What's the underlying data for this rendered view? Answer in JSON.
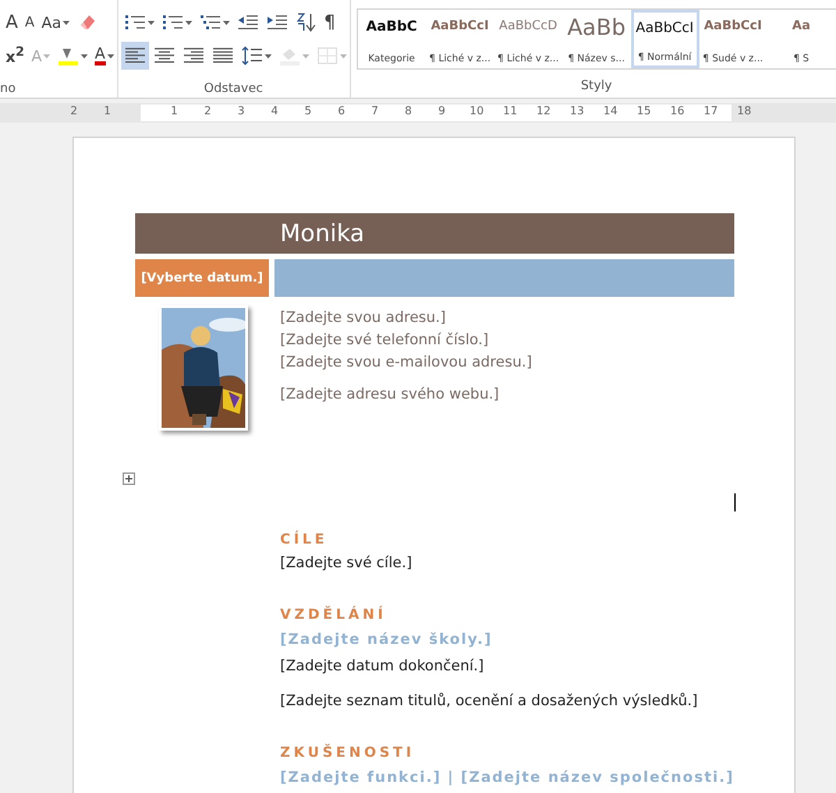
{
  "ribbon": {
    "groups": [
      {
        "label": "no",
        "rows": [
          [
            {
              "kind": "grow",
              "label": "A",
              "dropdown": false,
              "disabled": false,
              "selected": false
            },
            {
              "kind": "shrink",
              "label": "A",
              "dropdown": false,
              "disabled": false,
              "selected": false
            },
            {
              "kind": "case",
              "label": "Aa",
              "dropdown": true,
              "disabled": false,
              "selected": false
            },
            {
              "kind": "eraser",
              "dropdown": false,
              "disabled": false,
              "selected": false
            }
          ],
          [
            {
              "kind": "superscript",
              "label": "x$^{2}$",
              "dropdown": false,
              "disabled": false,
              "selected": false
            },
            {
              "kind": "effects",
              "label": "A",
              "dropdown": true,
              "disabled": true,
              "selected": false
            },
            {
              "kind": "highlight",
              "dropdown": true,
              "disabled": false,
              "selected": false
            },
            {
              "kind": "font-color",
              "label": "A",
              "dropdown": true,
              "disabled": false,
              "selected": false
            }
          ]
        ]
      },
      {
        "label": "Odstavec",
        "rows": [
          [
            {
              "kind": "bullets",
              "dropdown": true,
              "disabled": false,
              "selected": false
            },
            {
              "kind": "numbering",
              "dropdown": true,
              "disabled": false,
              "selected": false
            },
            {
              "kind": "multilevel",
              "dropdown": true,
              "disabled": false,
              "selected": false
            },
            {
              "kind": "outdent",
              "dropdown": false,
              "disabled": false,
              "selected": false
            },
            {
              "kind": "indent",
              "dropdown": false,
              "disabled": false,
              "selected": false
            },
            {
              "kind": "sort",
              "dropdown": false,
              "disabled": false,
              "selected": false
            },
            {
              "kind": "pilcrow",
              "label": "¶",
              "dropdown": false,
              "disabled": false,
              "selected": false
            }
          ],
          [
            {
              "kind": "align-left",
              "dropdown": false,
              "disabled": false,
              "selected": true
            },
            {
              "kind": "align-center",
              "dropdown": false,
              "disabled": false,
              "selected": false
            },
            {
              "kind": "align-right",
              "dropdown": false,
              "disabled": false,
              "selected": false
            },
            {
              "kind": "justify",
              "dropdown": false,
              "disabled": false,
              "selected": false
            },
            {
              "kind": "line-spacing",
              "dropdown": true,
              "disabled": false,
              "selected": false
            },
            {
              "kind": "shading",
              "dropdown": true,
              "disabled": true,
              "selected": false
            },
            {
              "kind": "borders",
              "dropdown": true,
              "disabled": true,
              "selected": false
            }
          ]
        ]
      }
    ],
    "styles": {
      "label": "Styly",
      "items": [
        {
          "preview": "AaBbC",
          "label": "Kategorie",
          "kind": "bold",
          "selected": false
        },
        {
          "preview": "AaBbCcI",
          "label": "¶ Liché v z...",
          "kind": "accent",
          "selected": false
        },
        {
          "preview": "AaBbCcD",
          "label": "¶ Liché v z...",
          "kind": "light",
          "selected": false
        },
        {
          "preview": "AaBb",
          "label": "¶ Název s...",
          "kind": "title",
          "selected": false
        },
        {
          "preview": "AaBbCcI",
          "label": "¶ Normální",
          "kind": "normal",
          "selected": true
        },
        {
          "preview": "AaBbCcI",
          "label": "¶ Sudé v z...",
          "kind": "accent",
          "selected": false
        },
        {
          "preview": "Aa",
          "label": "¶ S",
          "kind": "accent",
          "selected": false
        }
      ]
    }
  },
  "ruler": {
    "labels": [
      "2",
      "1",
      "1",
      "2",
      "3",
      "4",
      "5",
      "6",
      "7",
      "8",
      "9",
      "10",
      "11",
      "12",
      "13",
      "14",
      "15",
      "16",
      "17",
      "18"
    ]
  },
  "document": {
    "name": "Monika",
    "date": "[Vyberte datum.]",
    "contact": [
      "[Zadejte svou adresu.]",
      "[Zadejte své telefonní číslo.]",
      "[Zadejte svou e-mailovou adresu.]"
    ],
    "website": "[Zadejte adresu svého webu.]",
    "sections": [
      {
        "heading": "CÍLE",
        "lines": [
          {
            "kind": "text",
            "text": "[Zadejte své cíle.]"
          }
        ]
      },
      {
        "heading": "VZDĚLÁNÍ",
        "lines": [
          {
            "kind": "subheading",
            "text": "[Zadejte název školy.]"
          },
          {
            "kind": "text",
            "text": "[Zadejte datum dokončení.]"
          },
          {
            "kind": "paragraph",
            "text": "[Zadejte seznam titulů, ocenění a dosažených výsledků.]"
          }
        ]
      },
      {
        "heading": "ZKUŠENOSTI",
        "lines": [
          {
            "kind": "subheading",
            "text": "[Zadejte funkci.] | [Zadejte název společnosti.]"
          }
        ]
      }
    ]
  }
}
